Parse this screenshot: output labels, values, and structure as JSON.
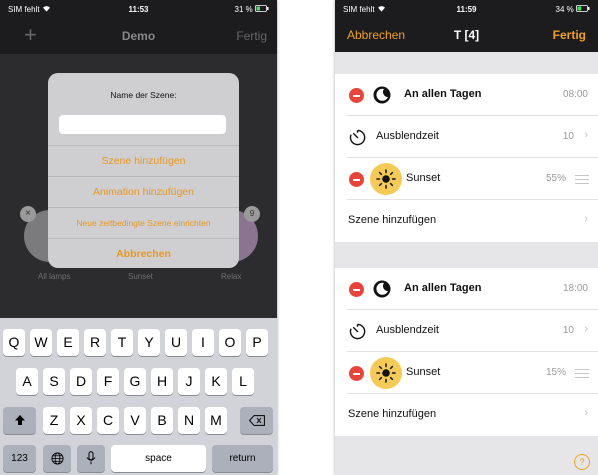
{
  "left": {
    "status": {
      "carrier": "SIM fehlt",
      "time": "11:53",
      "battery": "31 %"
    },
    "nav": {
      "plus": "+",
      "title": "Demo",
      "done": "Fertig"
    },
    "scenes": [
      {
        "label": "All lamps"
      },
      {
        "label": "Sunset"
      },
      {
        "label": "Relax"
      }
    ],
    "badges": {
      "close": "×",
      "count": "9"
    },
    "alert": {
      "title": "Name der Szene:",
      "input_value": "",
      "buttons": [
        "Szene hinzufügen",
        "Animation hinzufügen",
        "Neue zeitbedingte Szene einrichten",
        "Abbrechen"
      ]
    },
    "keyboard": {
      "row1": [
        "Q",
        "W",
        "E",
        "R",
        "T",
        "Y",
        "U",
        "I",
        "O",
        "P"
      ],
      "row2": [
        "A",
        "S",
        "D",
        "F",
        "G",
        "H",
        "J",
        "K",
        "L"
      ],
      "row3": [
        "Z",
        "X",
        "C",
        "V",
        "B",
        "N",
        "M"
      ],
      "numbers": "123",
      "space": "space",
      "return": "return"
    }
  },
  "right": {
    "status": {
      "carrier": "SIM fehlt",
      "time": "11:59",
      "battery": "34 %"
    },
    "nav": {
      "cancel": "Abbrechen",
      "title": "T [4]",
      "done": "Fertig"
    },
    "sections": [
      {
        "day_label": "An allen Tagen",
        "time": "08:00",
        "fade_label": "Ausblendzeit",
        "fade_value": "10",
        "scene_name": "Sunset",
        "scene_level": "55%",
        "add_label": "Szene hinzufügen"
      },
      {
        "day_label": "An allen Tagen",
        "time": "18:00",
        "fade_label": "Ausblendzeit",
        "fade_value": "10",
        "scene_name": "Sunset",
        "scene_level": "15%",
        "add_label": "Szene hinzufügen"
      }
    ],
    "help": "?"
  },
  "colors": {
    "accent": "#f0a020",
    "delete": "#e8443a",
    "sun": "#f6ca56"
  }
}
